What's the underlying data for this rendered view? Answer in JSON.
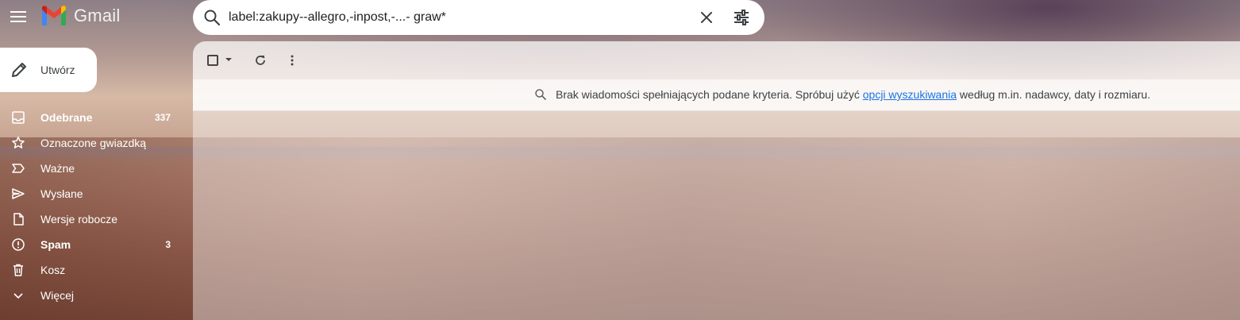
{
  "app": {
    "name": "Gmail"
  },
  "search": {
    "value": "label:zakupy--allegro,-inpost,-...- graw*",
    "clear_icon": "close-icon",
    "options_icon": "tune-icon"
  },
  "compose": {
    "label": "Utwórz"
  },
  "sidebar": {
    "items": [
      {
        "label": "Odebrane",
        "count": "337",
        "icon": "inbox-icon",
        "bold": true
      },
      {
        "label": "Oznaczone gwiazdką",
        "count": "",
        "icon": "star-icon",
        "bold": false
      },
      {
        "label": "Ważne",
        "count": "",
        "icon": "important-icon",
        "bold": false
      },
      {
        "label": "Wysłane",
        "count": "",
        "icon": "send-icon",
        "bold": false
      },
      {
        "label": "Wersje robocze",
        "count": "",
        "icon": "draft-icon",
        "bold": false
      },
      {
        "label": "Spam",
        "count": "3",
        "icon": "spam-icon",
        "bold": true
      },
      {
        "label": "Kosz",
        "count": "",
        "icon": "trash-icon",
        "bold": false
      },
      {
        "label": "Więcej",
        "count": "",
        "icon": "chevron-down-icon",
        "bold": false
      }
    ]
  },
  "results": {
    "message_before": "Brak wiadomości spełniających podane kryteria. Spróbuj użyć ",
    "link_text": "opcji wyszukiwania",
    "message_after": " według m.in. nadawcy, daty i rozmiaru."
  },
  "colors": {
    "link": "#1a73e8",
    "accent_red": "#ea4335"
  }
}
